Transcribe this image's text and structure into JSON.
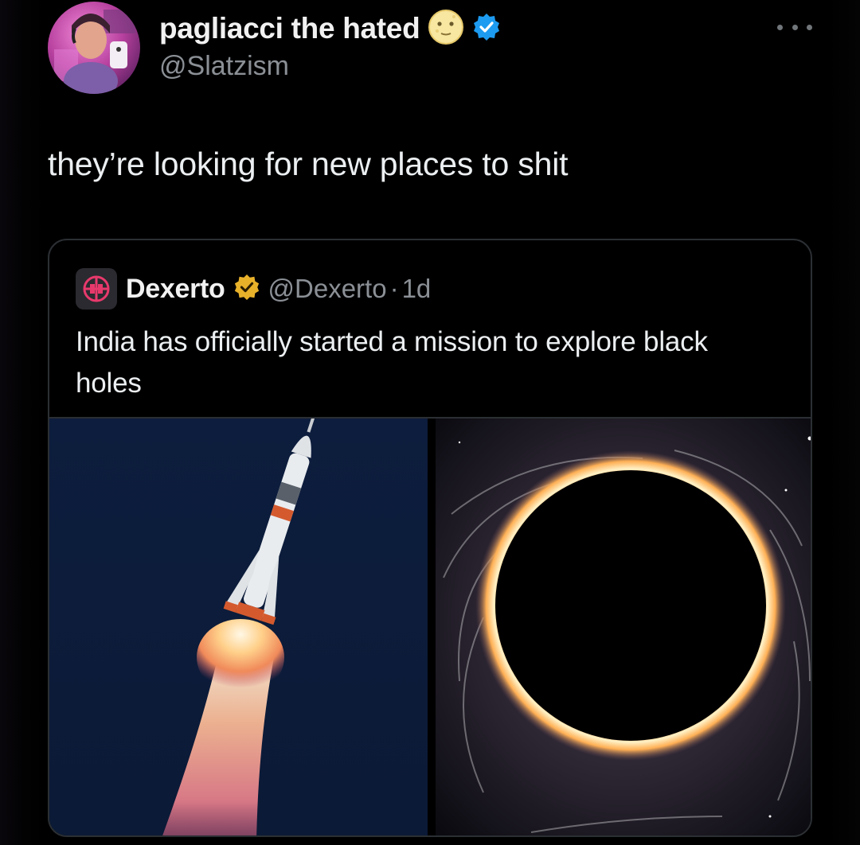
{
  "tweet": {
    "display_name": "pagliacci the hated",
    "handle": "@Slatzism",
    "text": "they’re looking for new places to shit",
    "name_emoji_icon": "moon-face-emoji-icon",
    "verified_icon": "verified-badge-icon",
    "more_icon": "more-options-icon"
  },
  "quote": {
    "display_name": "Dexerto",
    "handle": "@Dexerto",
    "separator": "·",
    "time": "1d",
    "text": "India has officially started a mission to explore black holes",
    "verified_icon": "gold-verified-badge-icon",
    "media": [
      {
        "icon": "rocket-launch-image"
      },
      {
        "icon": "black-hole-image"
      }
    ]
  },
  "colors": {
    "background": "#000000",
    "primary_text": "#eceff1",
    "secondary_text": "#8b9096",
    "verified_blue": "#1d9bf0",
    "verified_gold": "#e8b12a",
    "card_border": "#2b2f33"
  }
}
